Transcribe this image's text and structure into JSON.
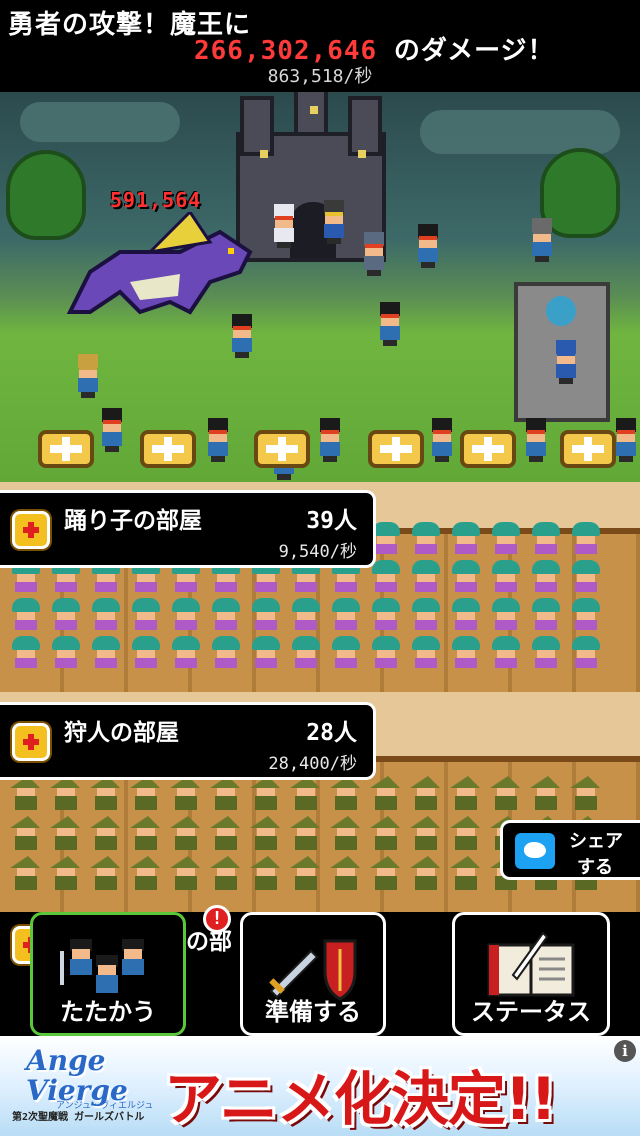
{
  "message": {
    "line1": "勇者の攻撃！魔王に",
    "damage": "266,302,646",
    "line2_suffix": "のダメージ！",
    "rate": "863,518/秒"
  },
  "battle": {
    "hit_value": "591,564"
  },
  "rooms": [
    {
      "name": "踊り子の部屋",
      "count": "39人",
      "rate": "9,540/秒"
    },
    {
      "name": "狩人の部屋",
      "count": "28人",
      "rate": "28,400/秒"
    }
  ],
  "peek_room": {
    "name_fragment": "の部"
  },
  "share": {
    "line1": "シェア",
    "line2": "する",
    "icon": "twitter-bird-icon"
  },
  "nav": {
    "fight": "たたかう",
    "equip": "準備する",
    "status": "ステータス",
    "alert": "!"
  },
  "ad": {
    "logo": "Ange Vierge",
    "logo_kana": "アンジュ・ヴィエルジュ",
    "logo_sub": "第2次聖魔戦 ガールズバトル",
    "headline": "アニメ化決定!!",
    "info": "i"
  },
  "colors": {
    "damage": "#ff3a3a",
    "active_tab_border": "#5ac83a",
    "ad_headline": "#d81818"
  }
}
